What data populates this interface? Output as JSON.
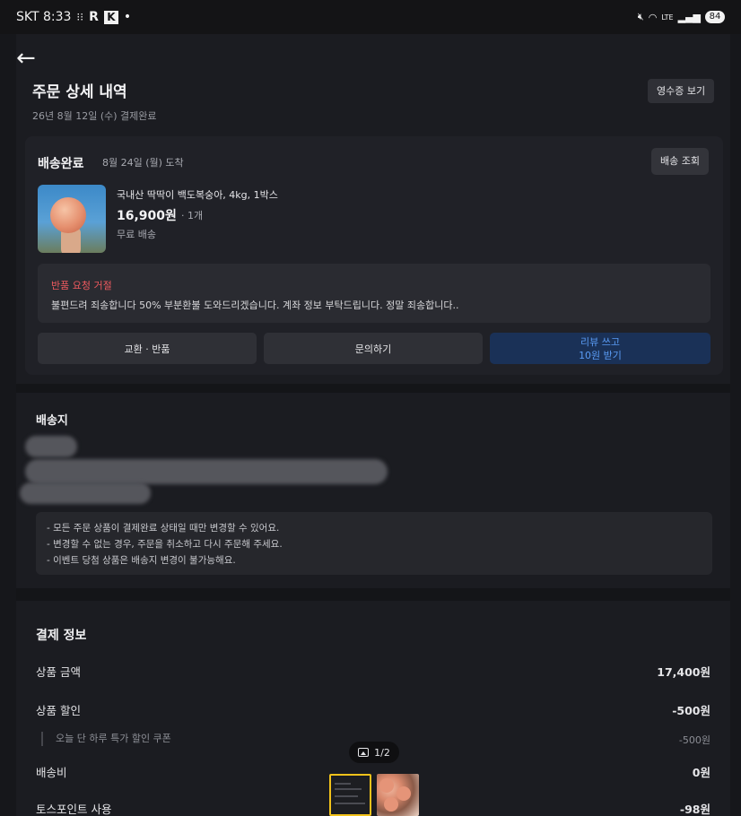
{
  "status_bar": {
    "carrier_time": "SKT 8:33",
    "glyphs": [
      "R",
      "K"
    ],
    "dot": "•",
    "net_label": "LTE",
    "battery": "84"
  },
  "header": {
    "title": "주문 상세 내역",
    "subtitle": "26년 8월 12일 (수) 결제완료",
    "receipt_button": "영수증 보기"
  },
  "order_card": {
    "status": "배송완료",
    "arrival": "8월 24일 (월) 도착",
    "track_button": "배송 조회",
    "product": {
      "name": "국내산 딱딱이 백도복숭아, 4kg, 1박스",
      "price": "16,900원",
      "qty": "· 1개",
      "shipping": "무료 배송"
    },
    "return_notice": {
      "title": "반품 요청 거절",
      "message": "불편드려 죄송합니다 50% 부분환불 도와드리겠습니다. 계좌 정보 부탁드립니다. 정말 죄송합니다.."
    },
    "buttons": {
      "exchange": "교환 · 반품",
      "inquiry": "문의하기",
      "review_line1": "리뷰 쓰고",
      "review_line2": "10원 받기"
    }
  },
  "shipping_section": {
    "title": "배송지",
    "notices": [
      "- 모든 주문 상품이 결제완료 상태일 때만 변경할 수 있어요.",
      "- 변경할 수 없는 경우, 주문을 취소하고 다시 주문해 주세요.",
      "- 이벤트 당첨 상품은 배송지 변경이 불가능해요."
    ]
  },
  "payment_section": {
    "title": "결제 정보",
    "rows": {
      "product_amount": {
        "label": "상품 금액",
        "value": "17,400원"
      },
      "product_discount": {
        "label": "상품 할인",
        "value": "-500원"
      },
      "coupon": {
        "label": "오늘 단 하루 특가 할인 쿠폰",
        "value": "-500원"
      },
      "shipping_fee": {
        "label": "배송비",
        "value": "0원"
      },
      "toss_points": {
        "label": "토스포인트 사용",
        "value": "-98원"
      }
    }
  },
  "image_viewer": {
    "page_indicator": "1/2"
  },
  "colors": {
    "background": "#1b1c21",
    "card": "#202127",
    "accent_blue": "#5a9cf5",
    "error_red": "#ef5a5f",
    "thumbnail_selected": "#f2c21b"
  }
}
